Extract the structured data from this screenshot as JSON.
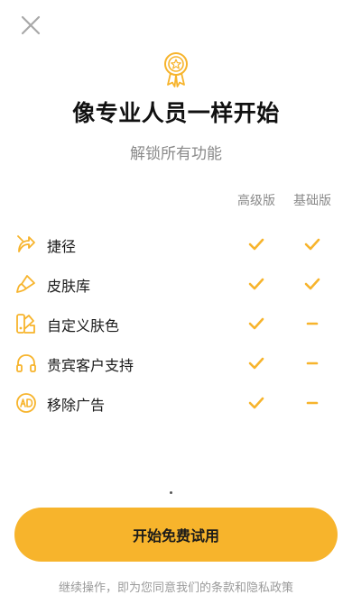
{
  "header": {
    "close_icon": "close-icon",
    "badge_icon": "medal-icon",
    "title": "像专业人员一样开始",
    "subtitle": "解锁所有功能"
  },
  "table": {
    "columns": [
      "高级版",
      "基础版"
    ],
    "rows": [
      {
        "label": "捷径",
        "icon": "shortcut-icon",
        "premium": "check",
        "basic": "check"
      },
      {
        "label": "皮肤库",
        "icon": "brush-icon",
        "premium": "check",
        "basic": "check"
      },
      {
        "label": "自定义肤色",
        "icon": "palette-icon",
        "premium": "check",
        "basic": "dash"
      },
      {
        "label": "贵宾客户支持",
        "icon": "headphones-icon",
        "premium": "check",
        "basic": "dash"
      },
      {
        "label": "移除广告",
        "icon": "no-ads-icon",
        "premium": "check",
        "basic": "dash"
      }
    ]
  },
  "cta": {
    "label": "开始免费试用"
  },
  "footer": {
    "terms": "继续操作，即为您同意我们的条款和隐私政策"
  },
  "colors": {
    "accent": "#f7b42c",
    "muted_text": "#8a8a8a"
  }
}
